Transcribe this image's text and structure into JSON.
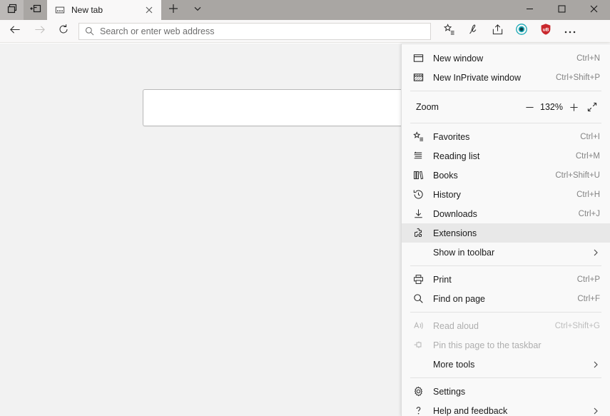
{
  "window": {
    "titlebar": {
      "left_buttons": [
        {
          "name": "show-tab-previews-icon",
          "label": "Show tab previews"
        },
        {
          "name": "set-tabs-aside-icon",
          "label": "Set these tabs aside"
        }
      ],
      "tabs": [
        {
          "title": "New tab",
          "favicon": "newtab-icon",
          "active": true,
          "close_label": "Close tab"
        }
      ],
      "new_tab_label": "New tab",
      "tab_menu_label": "Tab options",
      "controls": {
        "minimize": "Minimize",
        "maximize": "Maximize",
        "close": "Close"
      }
    },
    "navbar": {
      "back_label": "Back",
      "forward_label": "Forward",
      "forward_disabled": true,
      "refresh_label": "Refresh",
      "address": {
        "value": "",
        "placeholder": "Search or enter web address"
      },
      "tools": [
        {
          "name": "favorites-star-icon",
          "label": "Add to favorites or reading list"
        },
        {
          "name": "notes-pen-icon",
          "label": "Make a Web Note"
        },
        {
          "name": "share-icon",
          "label": "Share"
        },
        {
          "name": "extension-privacy-icon",
          "label": "Privacy extension",
          "color": "#1ba9b6"
        },
        {
          "name": "extension-ublock-icon",
          "label": "uBlock Origin",
          "color": "#c9282d",
          "badge_text": "uB"
        },
        {
          "name": "settings-and-more-icon",
          "label": "Settings and more"
        }
      ]
    }
  },
  "page": {
    "background_color": "#f2f2f2",
    "search_box": {
      "placeholder": "",
      "value": "",
      "logo_name": "bing-logo-icon"
    }
  },
  "menu": {
    "title": "Settings and more",
    "groups": [
      {
        "items": [
          {
            "label": "New window",
            "accel": "Ctrl+N",
            "icon": "new-window-icon",
            "disabled": false,
            "hovered": false,
            "chevron": false
          },
          {
            "label": "New InPrivate window",
            "accel": "Ctrl+Shift+P",
            "icon": "inprivate-window-icon",
            "disabled": false,
            "hovered": false,
            "chevron": false
          }
        ]
      },
      {
        "zoom": {
          "label": "Zoom",
          "value": "132%",
          "minus_label": "Zoom out",
          "plus_label": "Zoom in",
          "fullscreen_label": "Full screen"
        }
      },
      {
        "items": [
          {
            "label": "Favorites",
            "accel": "Ctrl+I",
            "icon": "favorites-icon",
            "disabled": false,
            "hovered": false,
            "chevron": false
          },
          {
            "label": "Reading list",
            "accel": "Ctrl+M",
            "icon": "reading-list-icon",
            "disabled": false,
            "hovered": false,
            "chevron": false
          },
          {
            "label": "Books",
            "accel": "Ctrl+Shift+U",
            "icon": "books-icon",
            "disabled": false,
            "hovered": false,
            "chevron": false
          },
          {
            "label": "History",
            "accel": "Ctrl+H",
            "icon": "history-icon",
            "disabled": false,
            "hovered": false,
            "chevron": false
          },
          {
            "label": "Downloads",
            "accel": "Ctrl+J",
            "icon": "downloads-icon",
            "disabled": false,
            "hovered": false,
            "chevron": false
          },
          {
            "label": "Extensions",
            "accel": "",
            "icon": "extensions-puzzle-icon",
            "disabled": false,
            "hovered": true,
            "chevron": false
          },
          {
            "label": "Show in toolbar",
            "accel": "",
            "icon": "",
            "disabled": false,
            "hovered": false,
            "chevron": true
          }
        ]
      },
      {
        "items": [
          {
            "label": "Print",
            "accel": "Ctrl+P",
            "icon": "print-icon",
            "disabled": false,
            "hovered": false,
            "chevron": false
          },
          {
            "label": "Find on page",
            "accel": "Ctrl+F",
            "icon": "find-magnifier-icon",
            "disabled": false,
            "hovered": false,
            "chevron": false
          }
        ]
      },
      {
        "items": [
          {
            "label": "Read aloud",
            "accel": "Ctrl+Shift+G",
            "icon": "read-aloud-icon",
            "disabled": true,
            "hovered": false,
            "chevron": false
          },
          {
            "label": "Pin this page to the taskbar",
            "accel": "",
            "icon": "pin-icon",
            "disabled": true,
            "hovered": false,
            "chevron": false
          },
          {
            "label": "More tools",
            "accel": "",
            "icon": "",
            "disabled": false,
            "hovered": false,
            "chevron": true
          }
        ]
      },
      {
        "items": [
          {
            "label": "Settings",
            "accel": "",
            "icon": "gear-icon",
            "disabled": false,
            "hovered": false,
            "chevron": false
          },
          {
            "label": "Help and feedback",
            "accel": "",
            "icon": "question-mark-icon",
            "disabled": false,
            "hovered": false,
            "chevron": true
          }
        ]
      }
    ]
  }
}
